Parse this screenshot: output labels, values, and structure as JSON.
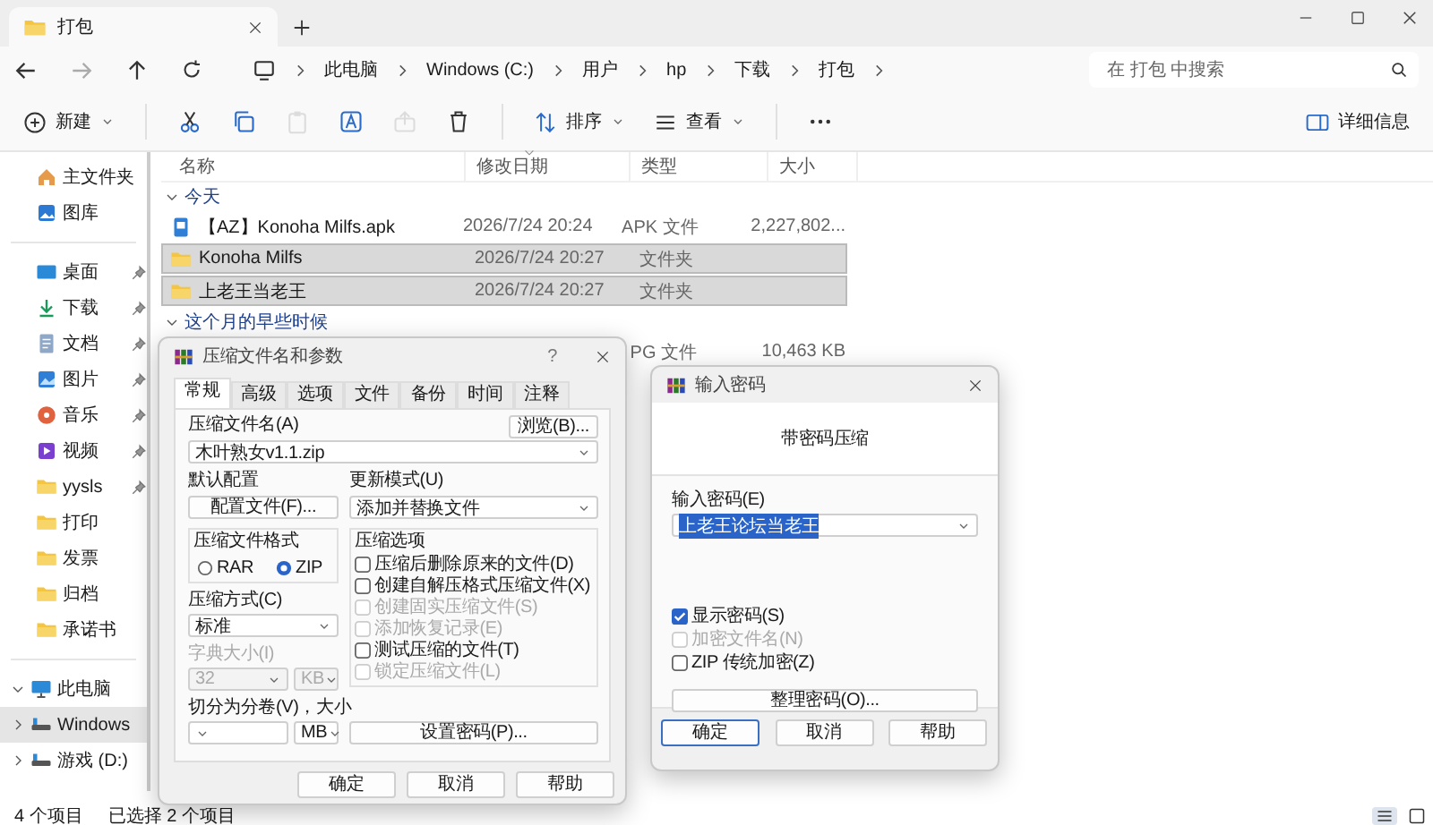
{
  "window": {
    "tab_title": "打包"
  },
  "address": {
    "breadcrumbs": [
      "此电脑",
      "Windows (C:)",
      "用户",
      "hp",
      "下载",
      "打包"
    ]
  },
  "search": {
    "placeholder": "在 打包 中搜索"
  },
  "toolbar": {
    "new": "新建",
    "sort": "排序",
    "view": "查看",
    "details": "详细信息",
    "icon_buttons": [
      {
        "kind": "cut",
        "disabled": false
      },
      {
        "kind": "copy",
        "disabled": false
      },
      {
        "kind": "paste",
        "disabled": true
      },
      {
        "kind": "rename",
        "disabled": false
      },
      {
        "kind": "share",
        "disabled": true
      },
      {
        "kind": "delete",
        "disabled": false
      }
    ]
  },
  "sidebar": {
    "sections": [
      {
        "items": [
          {
            "label": "主文件夹",
            "kind": "home",
            "pinned": false
          },
          {
            "label": "图库",
            "kind": "gallery",
            "pinned": false
          }
        ]
      },
      {
        "items": [
          {
            "label": "桌面",
            "kind": "desktop",
            "pinned": true
          },
          {
            "label": "下载",
            "kind": "download",
            "pinned": true
          },
          {
            "label": "文档",
            "kind": "documents",
            "pinned": true
          },
          {
            "label": "图片",
            "kind": "pictures",
            "pinned": true
          },
          {
            "label": "音乐",
            "kind": "music",
            "pinned": true
          },
          {
            "label": "视频",
            "kind": "videos",
            "pinned": true
          },
          {
            "label": "yysls",
            "kind": "folder",
            "pinned": true
          },
          {
            "label": "打印",
            "kind": "folder",
            "pinned": false
          },
          {
            "label": "发票",
            "kind": "folder",
            "pinned": false
          },
          {
            "label": "归档",
            "kind": "folder",
            "pinned": false
          },
          {
            "label": "承诺书",
            "kind": "folder",
            "pinned": false
          }
        ]
      },
      {
        "items": [
          {
            "label": "此电脑",
            "kind": "pc",
            "expanded": true,
            "selected": false,
            "children": [
              {
                "label": "Windows",
                "kind": "drive",
                "expanded": false,
                "selected": true
              },
              {
                "label": "游戏 (D:)",
                "kind": "drive",
                "expanded": false,
                "selected": false
              }
            ]
          }
        ]
      }
    ]
  },
  "table": {
    "columns": [
      "名称",
      "修改日期",
      "类型",
      "大小"
    ],
    "groups": [
      {
        "label": "今天",
        "expanded": true,
        "rows": [
          {
            "name": "【AZ】Konoha Milfs.apk",
            "date": "2026/7/24 20:24",
            "type": "APK 文件",
            "size": "2,227,802...",
            "kind": "apk",
            "selected": false
          },
          {
            "name": "Konoha Milfs",
            "date": "2026/7/24 20:27",
            "type": "文件夹",
            "kind": "folder",
            "selected": true
          },
          {
            "name": "上老王当老王",
            "date": "2026/7/24 20:27",
            "type": "文件夹",
            "kind": "folder",
            "selected": true
          }
        ]
      },
      {
        "label": "这个月的早些时候",
        "expanded": true,
        "rows": [
          {
            "type": "PG 文件",
            "size": "10,463 KB",
            "selected": false
          }
        ]
      }
    ]
  },
  "status_bar": {
    "count": "4 个项目",
    "selection": "已选择 2 个项目",
    "views": [
      {
        "kind": "details",
        "selected": true
      },
      {
        "kind": "tiles",
        "selected": false
      }
    ]
  },
  "archive_dialog": {
    "title": "压缩文件名和参数",
    "help": "?",
    "tabs": [
      {
        "label": "常规",
        "selected": true
      },
      {
        "label": "高级",
        "selected": false
      },
      {
        "label": "选项",
        "selected": false
      },
      {
        "label": "文件",
        "selected": false
      },
      {
        "label": "备份",
        "selected": false
      },
      {
        "label": "时间",
        "selected": false
      },
      {
        "label": "注释",
        "selected": false
      }
    ],
    "name_label": "压缩文件名(A)",
    "browse": "浏览(B)...",
    "name": "木叶熟女v1.1.zip",
    "profile_label": "默认配置",
    "profile_button": "配置文件(F)...",
    "update_label": "更新模式(U)",
    "update_mode": "添加并替换文件",
    "format_label": "压缩文件格式",
    "formats": [
      {
        "label": "RAR",
        "selected": false
      },
      {
        "label": "ZIP",
        "selected": true
      }
    ],
    "method_label": "压缩方式(C)",
    "method": "标准",
    "dictionary": {
      "label": "字典大小(I)",
      "value": "32",
      "unit": "KB",
      "disabled": true
    },
    "options_label": "压缩选项",
    "options": [
      {
        "label": "压缩后删除原来的文件(D)",
        "checked": false,
        "disabled": false
      },
      {
        "label": "创建自解压格式压缩文件(X)",
        "checked": false,
        "disabled": false
      },
      {
        "label": "创建固实压缩文件(S)",
        "checked": false,
        "disabled": true
      },
      {
        "label": "添加恢复记录(E)",
        "checked": false,
        "disabled": true
      },
      {
        "label": "测试压缩的文件(T)",
        "checked": false,
        "disabled": false
      },
      {
        "label": "锁定压缩文件(L)",
        "checked": false,
        "disabled": true
      }
    ],
    "split_label": "切分为分卷(V)，大小",
    "split_unit": "MB",
    "password_button": "设置密码(P)...",
    "buttons": [
      {
        "label": "确定",
        "default": false
      },
      {
        "label": "取消",
        "default": false
      },
      {
        "label": "帮助",
        "default": false
      }
    ]
  },
  "password_dialog": {
    "title": "输入密码",
    "heading": "带密码压缩",
    "password_label": "输入密码(E)",
    "password": "上老王论坛当老王",
    "password_highlighted": true,
    "options": [
      {
        "label": "显示密码(S)",
        "checked": true,
        "disabled": false
      },
      {
        "label": "加密文件名(N)",
        "checked": false,
        "disabled": true
      },
      {
        "label": "ZIP 传统加密(Z)",
        "checked": false,
        "disabled": false
      }
    ],
    "organize_button": "整理密码(O)...",
    "buttons": [
      {
        "label": "确定",
        "default": true
      },
      {
        "label": "取消",
        "default": false
      },
      {
        "label": "帮助",
        "default": false
      }
    ]
  }
}
